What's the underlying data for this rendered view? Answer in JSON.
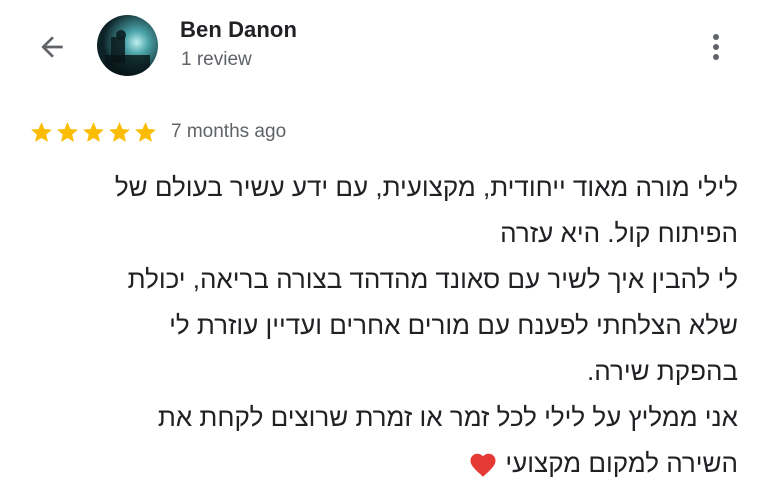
{
  "header": {
    "author_name": "Ben Danon",
    "review_count": "1 review",
    "back_icon": "arrow-back-icon",
    "more_icon": "more-vert-icon"
  },
  "rating": {
    "stars": 5,
    "max_stars": 5,
    "star_color": "#fbbc04",
    "date": "7 months ago"
  },
  "review": {
    "lines": [
      "לילי מורה מאוד ייחודית, מקצועית, עם ידע עשיר בעולם של",
      "הפיתוח קול. היא עזרה",
      "לי להבין איך לשיר עם סאונד מהדהד בצורה בריאה, יכולת",
      "שלא הצלחתי לפענח עם מורים אחרים ועדיין עוזרת לי",
      "בהפקת שירה.",
      "אני ממליץ על לילי לכל זמר או זמרת שרוצים לקחת את",
      "השירה למקום מקצועי"
    ],
    "emoji": "heart-emoji-icon",
    "emoji_color": "#e53935"
  }
}
